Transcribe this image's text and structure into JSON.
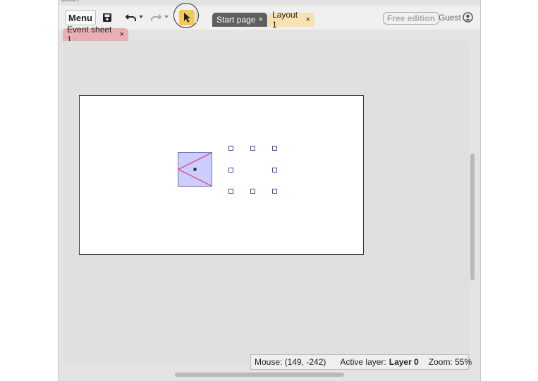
{
  "window": {
    "title_fragment": "ctmet"
  },
  "toolbar": {
    "menu_label": "Menu",
    "icons": [
      "save-icon",
      "undo-icon",
      "undo-dropdown-icon",
      "redo-icon",
      "redo-dropdown-icon",
      "select-tool-icon"
    ]
  },
  "tabs": [
    {
      "label": "Start page",
      "close": "×"
    },
    {
      "label": "Layout 1",
      "close": "×"
    }
  ],
  "subtabs": [
    {
      "label": "Event sheet 1",
      "close": "×"
    }
  ],
  "account": {
    "edition": "Free edition",
    "user": "Guest"
  },
  "status": {
    "mouse_label": "Mouse: (149, -242)",
    "active_layer_label": "Active layer:",
    "active_layer_value": "Layer 0",
    "zoom_label": "Zoom: 55%"
  },
  "colors": {
    "active_tool": "#f3c95a",
    "start_tab": "#5f5f5f",
    "layout_tab": "#f7e2b0",
    "event_tab": "#e9b0b4",
    "object_fill": "#ccccff",
    "object_lines": "#d4507a"
  }
}
